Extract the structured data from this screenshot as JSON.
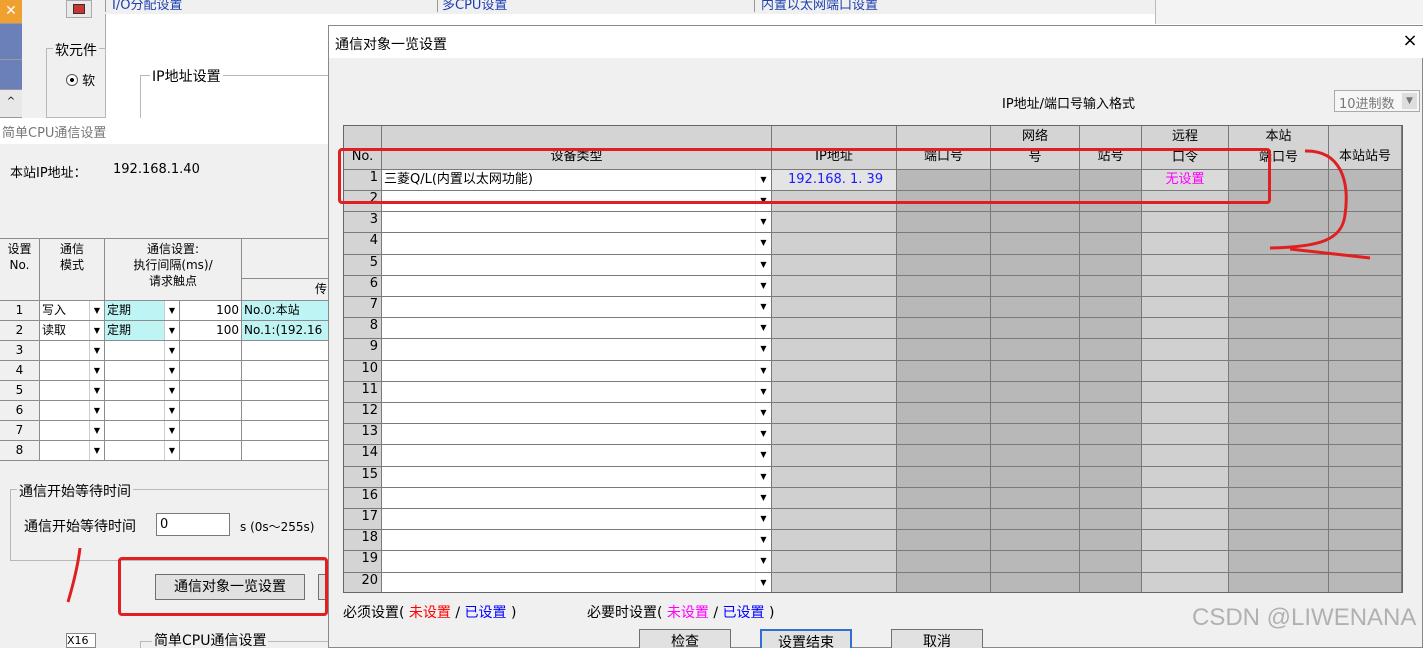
{
  "background": {
    "tabs": [
      "I/O分配设置",
      "多CPU设置",
      "内置以太网端口设置"
    ],
    "soft_group_label": "软元件",
    "ip_group_label": "IP地址设置",
    "radio_label_1": "软",
    "bottom_item": "X16",
    "bottom_group_label": "简单CPU通信设置"
  },
  "left_dialog": {
    "title": "简单CPU通信设置",
    "host_ip_label": "本站IP地址：",
    "host_ip_value": "192.168.1.40",
    "headers": {
      "no_line1": "设置",
      "no_line2": "No.",
      "mode_line1": "通信",
      "mode_line2": "模式",
      "setting_line1": "通信设置:",
      "setting_line2": "执行间隔(ms)/",
      "setting_line3": "请求触点",
      "target_line1": "传"
    },
    "rows": [
      {
        "no": "1",
        "mode": "写入",
        "type": "定期",
        "interval": "100",
        "target": "No.0:本站"
      },
      {
        "no": "2",
        "mode": "读取",
        "type": "定期",
        "interval": "100",
        "target": "No.1:(192.16"
      },
      {
        "no": "3",
        "mode": "",
        "type": "",
        "interval": "",
        "target": ""
      },
      {
        "no": "4",
        "mode": "",
        "type": "",
        "interval": "",
        "target": ""
      },
      {
        "no": "5",
        "mode": "",
        "type": "",
        "interval": "",
        "target": ""
      },
      {
        "no": "6",
        "mode": "",
        "type": "",
        "interval": "",
        "target": ""
      },
      {
        "no": "7",
        "mode": "",
        "type": "",
        "interval": "",
        "target": ""
      },
      {
        "no": "8",
        "mode": "",
        "type": "",
        "interval": "",
        "target": ""
      }
    ],
    "wait_group_label": "通信开始等待时间",
    "wait_label": "通信开始等待时间",
    "wait_value": "0",
    "wait_unit": "s  (0s～255s)",
    "list_button": "通信对象一览设置"
  },
  "main_dialog": {
    "title": "通信对象一览设置",
    "close_glyph": "×",
    "input_format_label": "IP地址/端口号输入格式",
    "input_format_value": "10进制数",
    "columns": {
      "no": "No.",
      "device_type": "设备类型",
      "ip": "IP地址",
      "port": "端口号",
      "network_top": "网络",
      "network_bottom": "号",
      "station": "站号",
      "remote_top": "远程",
      "remote_bottom": "口令",
      "local_top": "本站",
      "local_bottom": "端口号",
      "local_station": "本站站号"
    },
    "row1": {
      "no": "1",
      "device_type": "三菱Q/L(内置以太网功能)",
      "ip": "192.168.  1. 39",
      "remote": "无设置"
    },
    "row_numbers": [
      "2",
      "3",
      "4",
      "5",
      "6",
      "7",
      "8",
      "9",
      "10",
      "11",
      "12",
      "13",
      "14",
      "15",
      "16",
      "17",
      "18",
      "19",
      "20"
    ],
    "legend": {
      "required_prefix": "必须设置(",
      "required_unset": "未设置",
      "required_sep": "/",
      "required_set": "已设置",
      "required_suffix": ")",
      "optional_prefix": "必要时设置(",
      "optional_unset": "未设置",
      "optional_sep": "/",
      "optional_set": "已设置",
      "optional_suffix": ")"
    },
    "buttons": {
      "check": "检查",
      "finish": "设置结束",
      "cancel": "取消"
    }
  },
  "watermark": "CSDN @LIWENANA",
  "colors": {
    "annotation_red": "#e02020",
    "unset_red": "#ff0000",
    "set_blue": "#0000ff",
    "optional_magenta": "#ff00ff",
    "selected_row_cyan": "#bff4f4",
    "tab_text_blue": "#1e3fb0"
  }
}
